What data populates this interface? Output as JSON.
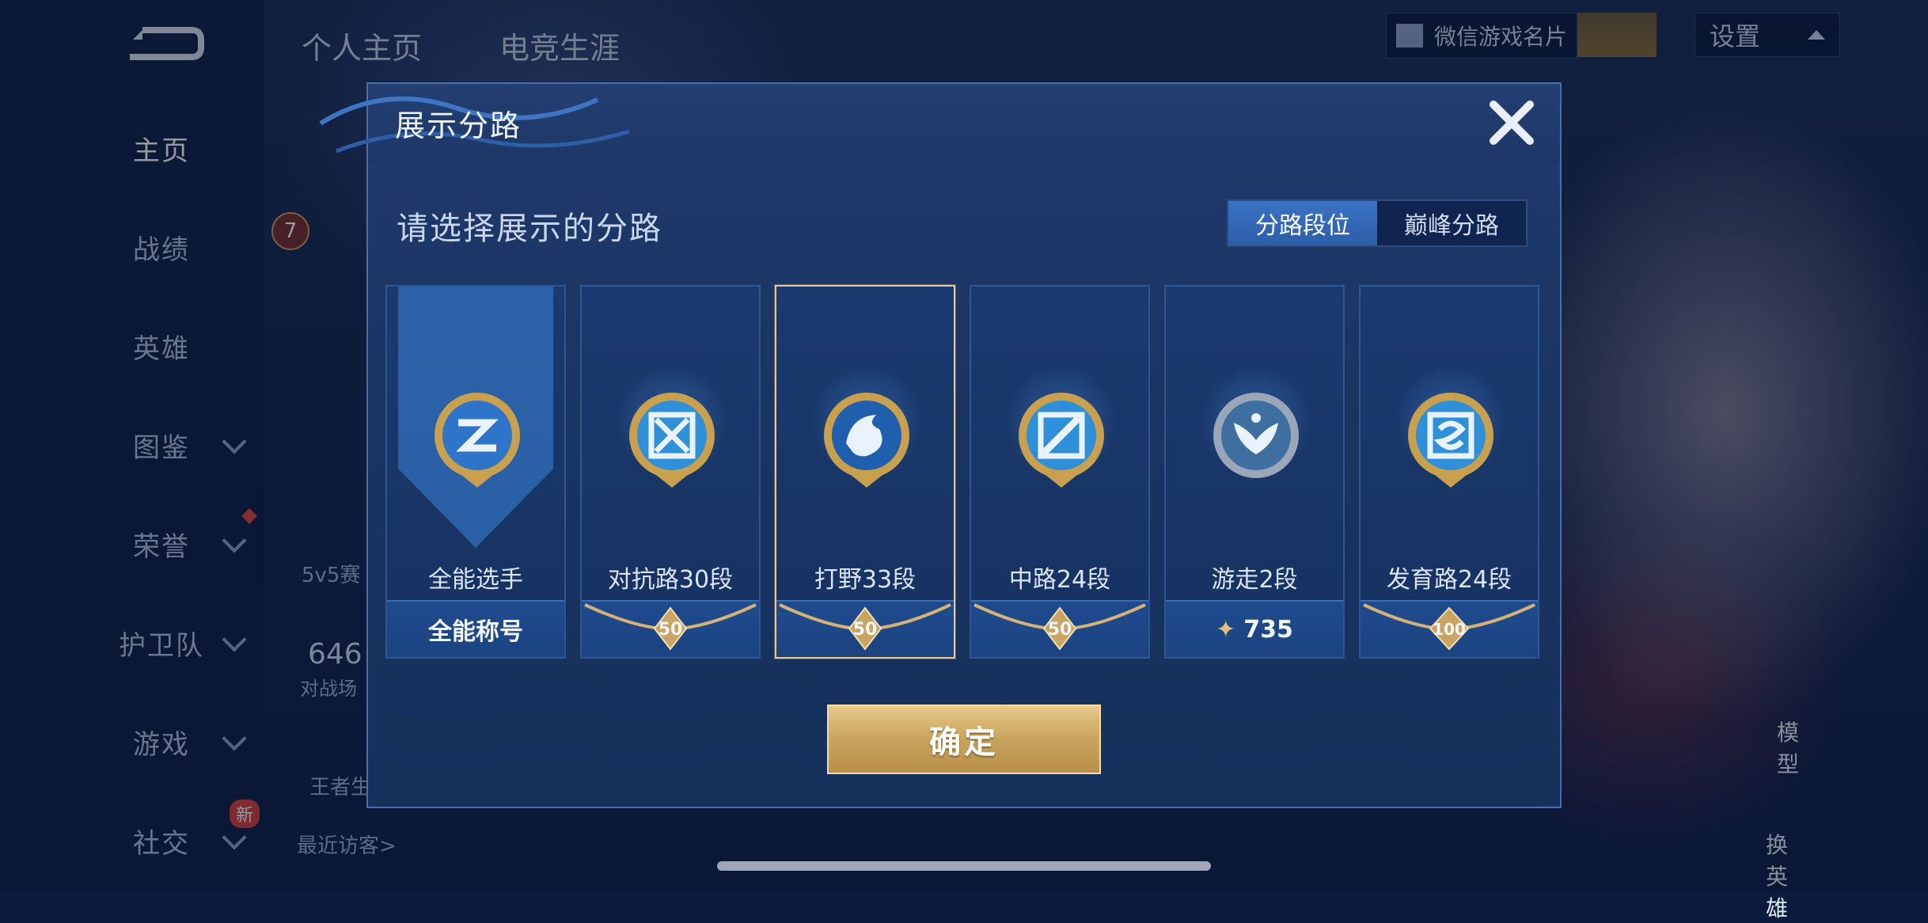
{
  "nav": {
    "items": [
      {
        "label": "主页",
        "chevron": false
      },
      {
        "label": "战绩",
        "chevron": false
      },
      {
        "label": "英雄",
        "chevron": false
      },
      {
        "label": "图鉴",
        "chevron": true
      },
      {
        "label": "荣誉",
        "chevron": true
      },
      {
        "label": "护卫队",
        "chevron": true
      },
      {
        "label": "游戏",
        "chevron": true
      },
      {
        "label": "社交",
        "chevron": true
      }
    ],
    "new_badge": "新"
  },
  "profile": {
    "tabs": [
      "个人主页",
      "电竞生涯"
    ],
    "wechat_card": "微信游戏名片",
    "settings": "设置",
    "level": "7",
    "mode_text": "5v5赛",
    "stat_number": "646",
    "stat_label": "对战场",
    "king_text": "王者生",
    "recent_visitors": "最近访客>",
    "model_label": "模型",
    "swap_hero": "换英雄",
    "new_tag": "新"
  },
  "modal": {
    "title": "展示分路",
    "subtitle": "请选择展示的分路",
    "toggle": [
      {
        "label": "分路段位",
        "active": true
      },
      {
        "label": "巅峰分路",
        "active": false
      }
    ],
    "cards": [
      {
        "name": "全能选手",
        "footer": "全能称号",
        "footer_type": "text",
        "icon": "all-round-icon",
        "selected": false
      },
      {
        "name": "对抗路30段",
        "footer": "50",
        "footer_type": "tier",
        "icon": "clash-lane-icon",
        "selected": false
      },
      {
        "name": "打野33段",
        "footer": "50",
        "footer_type": "tier",
        "icon": "jungle-dragon-icon",
        "selected": true
      },
      {
        "name": "中路24段",
        "footer": "50",
        "footer_type": "tier",
        "icon": "mid-lane-icon",
        "selected": false
      },
      {
        "name": "游走2段",
        "footer": "735",
        "footer_type": "points",
        "icon": "roam-wings-icon",
        "selected": false
      },
      {
        "name": "发育路24段",
        "footer": "100",
        "footer_type": "tier",
        "icon": "farm-lane-icon",
        "selected": false
      }
    ],
    "confirm": "确定"
  },
  "colors": {
    "accent_blue": "#3a73c4",
    "gold": "#e6c98a",
    "panel": "#1a3462"
  }
}
